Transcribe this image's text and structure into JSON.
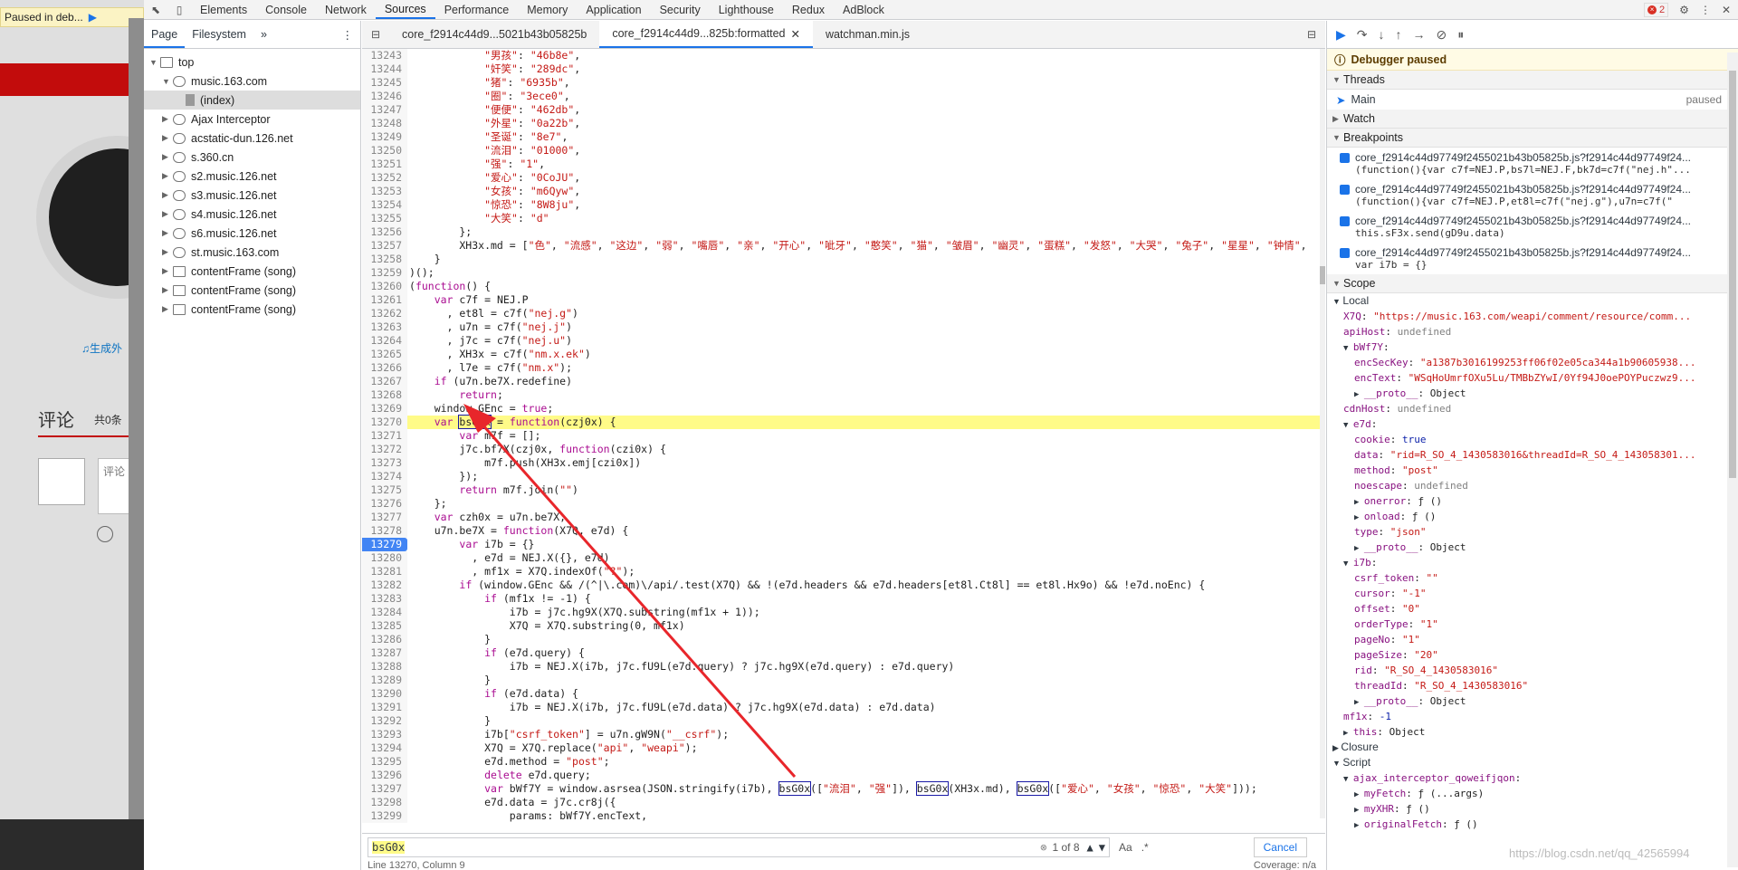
{
  "page": {
    "paused_label": "Paused in deb...",
    "lyric_link": "♫生成外",
    "comment_title": "评论",
    "comment_count": "共0条",
    "comment_placeholder": "评论"
  },
  "tabs": [
    "Elements",
    "Console",
    "Network",
    "Sources",
    "Performance",
    "Memory",
    "Application",
    "Security",
    "Lighthouse",
    "Redux",
    "AdBlock"
  ],
  "active_tab": "Sources",
  "error_count": "2",
  "navigator": {
    "tabs": [
      "Page",
      "Filesystem"
    ],
    "more": "»",
    "items": [
      {
        "label": "top",
        "icon": "folder",
        "depth": 0,
        "open": true
      },
      {
        "label": "music.163.com",
        "icon": "cloud",
        "depth": 1,
        "open": true
      },
      {
        "label": "(index)",
        "icon": "file",
        "depth": 2,
        "open": false,
        "selected": true
      },
      {
        "label": "Ajax Interceptor",
        "icon": "cloud",
        "depth": 1
      },
      {
        "label": "acstatic-dun.126.net",
        "icon": "cloud",
        "depth": 1
      },
      {
        "label": "s.360.cn",
        "icon": "cloud",
        "depth": 1
      },
      {
        "label": "s2.music.126.net",
        "icon": "cloud",
        "depth": 1
      },
      {
        "label": "s3.music.126.net",
        "icon": "cloud",
        "depth": 1
      },
      {
        "label": "s4.music.126.net",
        "icon": "cloud",
        "depth": 1
      },
      {
        "label": "s6.music.126.net",
        "icon": "cloud",
        "depth": 1
      },
      {
        "label": "st.music.163.com",
        "icon": "cloud",
        "depth": 1
      },
      {
        "label": "contentFrame (song)",
        "icon": "folder",
        "depth": 1
      },
      {
        "label": "contentFrame (song)",
        "icon": "folder",
        "depth": 1
      },
      {
        "label": "contentFrame (song)",
        "icon": "folder",
        "depth": 1
      }
    ]
  },
  "editor_tabs": [
    {
      "label": "core_f2914c44d9...5021b43b05825b",
      "active": false
    },
    {
      "label": "core_f2914c44d9...825b:formatted",
      "active": true,
      "closable": true
    },
    {
      "label": "watchman.min.js",
      "active": false
    }
  ],
  "code": {
    "breakpoint_line": 13279,
    "highlight_line": 13270,
    "lines": [
      [
        13243,
        "            \"男孩\": \"46b8e\","
      ],
      [
        13244,
        "            \"奸笑\": \"289dc\","
      ],
      [
        13245,
        "            \"猪\": \"6935b\","
      ],
      [
        13246,
        "            \"圈\": \"3ece0\","
      ],
      [
        13247,
        "            \"便便\": \"462db\","
      ],
      [
        13248,
        "            \"外星\": \"0a22b\","
      ],
      [
        13249,
        "            \"圣诞\": \"8e7\","
      ],
      [
        13250,
        "            \"流泪\": \"01000\","
      ],
      [
        13251,
        "            \"强\": \"1\","
      ],
      [
        13252,
        "            \"爱心\": \"0CoJU\","
      ],
      [
        13253,
        "            \"女孩\": \"m6Qyw\","
      ],
      [
        13254,
        "            \"惊恐\": \"8W8ju\","
      ],
      [
        13255,
        "            \"大笑\": \"d\""
      ],
      [
        13256,
        "        };"
      ],
      [
        13257,
        "        XH3x.md = [\"色\", \"流感\", \"这边\", \"弱\", \"嘴唇\", \"亲\", \"开心\", \"呲牙\", \"憨笑\", \"猫\", \"皱眉\", \"幽灵\", \"蛋糕\", \"发怒\", \"大哭\", \"兔子\", \"星星\", \"钟情\","
      ],
      [
        13258,
        "    }"
      ],
      [
        13259,
        ")();"
      ],
      [
        13260,
        "(function() {"
      ],
      [
        13261,
        "    var c7f = NEJ.P"
      ],
      [
        13262,
        "      , et8l = c7f(\"nej.g\")"
      ],
      [
        13263,
        "      , u7n = c7f(\"nej.j\")"
      ],
      [
        13264,
        "      , j7c = c7f(\"nej.u\")"
      ],
      [
        13265,
        "      , XH3x = c7f(\"nm.x.ek\")"
      ],
      [
        13266,
        "      , l7e = c7f(\"nm.x\");"
      ],
      [
        13267,
        "    if (u7n.be7X.redefine)"
      ],
      [
        13268,
        "        return;"
      ],
      [
        13269,
        "    window.GEnc = true;"
      ],
      [
        13270,
        "    var bsG0x = function(czj0x) {"
      ],
      [
        13271,
        "        var m7f = [];"
      ],
      [
        13272,
        "        j7c.bf7X(czj0x, function(czi0x) {"
      ],
      [
        13273,
        "            m7f.push(XH3x.emj[czi0x])"
      ],
      [
        13274,
        "        });"
      ],
      [
        13275,
        "        return m7f.join(\"\")"
      ],
      [
        13276,
        "    };"
      ],
      [
        13277,
        "    var czh0x = u7n.be7X;"
      ],
      [
        13278,
        "    u7n.be7X = function(X7Q, e7d) {"
      ],
      [
        13279,
        "        var i7b = {}"
      ],
      [
        13280,
        "          , e7d = NEJ.X({}, e7d)"
      ],
      [
        13281,
        "          , mf1x = X7Q.indexOf(\"?\");"
      ],
      [
        13282,
        "        if (window.GEnc && /(^|\\.com)\\/api/.test(X7Q) && !(e7d.headers && e7d.headers[et8l.Ct8l] == et8l.Hx9o) && !e7d.noEnc) {"
      ],
      [
        13283,
        "            if (mf1x != -1) {"
      ],
      [
        13284,
        "                i7b = j7c.hg9X(X7Q.substring(mf1x + 1));"
      ],
      [
        13285,
        "                X7Q = X7Q.substring(0, mf1x)"
      ],
      [
        13286,
        "            }"
      ],
      [
        13287,
        "            if (e7d.query) {"
      ],
      [
        13288,
        "                i7b = NEJ.X(i7b, j7c.fU9L(e7d.query) ? j7c.hg9X(e7d.query) : e7d.query)"
      ],
      [
        13289,
        "            }"
      ],
      [
        13290,
        "            if (e7d.data) {"
      ],
      [
        13291,
        "                i7b = NEJ.X(i7b, j7c.fU9L(e7d.data) ? j7c.hg9X(e7d.data) : e7d.data)"
      ],
      [
        13292,
        "            }"
      ],
      [
        13293,
        "            i7b[\"csrf_token\"] = u7n.gW9N(\"__csrf\");"
      ],
      [
        13294,
        "            X7Q = X7Q.replace(\"api\", \"weapi\");"
      ],
      [
        13295,
        "            e7d.method = \"post\";"
      ],
      [
        13296,
        "            delete e7d.query;"
      ],
      [
        13297,
        "            var bWf7Y = window.asrsea(JSON.stringify(i7b), bsG0x([\"流泪\", \"强\"]), bsG0x(XH3x.md), bsG0x([\"爱心\", \"女孩\", \"惊恐\", \"大笑\"]));"
      ],
      [
        13298,
        "            e7d.data = j7c.cr8j({"
      ],
      [
        13299,
        "                params: bWf7Y.encText,"
      ]
    ]
  },
  "search": {
    "query": "bsG0x",
    "match": "1 of 8",
    "aa": "Aa",
    "regex": ".*",
    "cancel": "Cancel"
  },
  "status": {
    "position": "Line 13270, Column 9",
    "coverage": "Coverage: n/a"
  },
  "sidebar": {
    "paused": "Debugger paused",
    "threads_label": "Threads",
    "thread_name": "Main",
    "thread_state": "paused",
    "watch_label": "Watch",
    "breakpoints_label": "Breakpoints",
    "breakpoints": [
      {
        "file": "core_f2914c44d97749f2455021b43b05825b.js?f2914c44d97749f24...",
        "code": "(function(){var c7f=NEJ.P,bs7l=NEJ.F,bk7d=c7f(\"nej.h\"..."
      },
      {
        "file": "core_f2914c44d97749f2455021b43b05825b.js?f2914c44d97749f24...",
        "code": "(function(){var c7f=NEJ.P,et8l=c7f(\"nej.g\"),u7n=c7f(\""
      },
      {
        "file": "core_f2914c44d97749f2455021b43b05825b.js?f2914c44d97749f24...",
        "code": "this.sF3x.send(gD9u.data)"
      },
      {
        "file": "core_f2914c44d97749f2455021b43b05825b.js?f2914c44d97749f24...",
        "code": "var i7b = {}"
      }
    ],
    "scope_label": "Scope",
    "local_label": "Local",
    "closure_label": "Closure",
    "script_label": "Script",
    "scope": [
      {
        "d": 1,
        "k": "X7Q",
        "v": "\"https://music.163.com/weapi/comment/resource/comm...",
        "t": "s"
      },
      {
        "d": 1,
        "k": "apiHost",
        "v": "undefined",
        "t": "u"
      },
      {
        "d": 1,
        "k": "bWf7Y",
        "v": "",
        "t": "o",
        "open": true
      },
      {
        "d": 2,
        "k": "encSecKey",
        "v": "\"a1387b3016199253ff06f02e05ca344a1b90605938...",
        "t": "s"
      },
      {
        "d": 2,
        "k": "encText",
        "v": "\"WSqHoUmrfOXu5Lu/TMBbZYwI/0Yf94J0oePOYPuczwz9...",
        "t": "s"
      },
      {
        "d": 2,
        "k": "__proto__",
        "v": "Object",
        "t": "p",
        "closed": true
      },
      {
        "d": 1,
        "k": "cdnHost",
        "v": "undefined",
        "t": "u"
      },
      {
        "d": 1,
        "k": "e7d",
        "v": "",
        "t": "o",
        "open": true
      },
      {
        "d": 2,
        "k": "cookie",
        "v": "true",
        "t": "b"
      },
      {
        "d": 2,
        "k": "data",
        "v": "\"rid=R_SO_4_1430583016&threadId=R_SO_4_143058301...",
        "t": "s"
      },
      {
        "d": 2,
        "k": "method",
        "v": "\"post\"",
        "t": "s"
      },
      {
        "d": 2,
        "k": "noescape",
        "v": "undefined",
        "t": "u"
      },
      {
        "d": 2,
        "k": "onerror",
        "v": "ƒ ()",
        "t": "f",
        "closed": true
      },
      {
        "d": 2,
        "k": "onload",
        "v": "ƒ ()",
        "t": "f",
        "closed": true
      },
      {
        "d": 2,
        "k": "type",
        "v": "\"json\"",
        "t": "s"
      },
      {
        "d": 2,
        "k": "__proto__",
        "v": "Object",
        "t": "p",
        "closed": true
      },
      {
        "d": 1,
        "k": "i7b",
        "v": "",
        "t": "o",
        "open": true
      },
      {
        "d": 2,
        "k": "csrf_token",
        "v": "\"\"",
        "t": "s"
      },
      {
        "d": 2,
        "k": "cursor",
        "v": "\"-1\"",
        "t": "s"
      },
      {
        "d": 2,
        "k": "offset",
        "v": "\"0\"",
        "t": "s"
      },
      {
        "d": 2,
        "k": "orderType",
        "v": "\"1\"",
        "t": "s"
      },
      {
        "d": 2,
        "k": "pageNo",
        "v": "\"1\"",
        "t": "s"
      },
      {
        "d": 2,
        "k": "pageSize",
        "v": "\"20\"",
        "t": "s"
      },
      {
        "d": 2,
        "k": "rid",
        "v": "\"R_SO_4_1430583016\"",
        "t": "s"
      },
      {
        "d": 2,
        "k": "threadId",
        "v": "\"R_SO_4_1430583016\"",
        "t": "s"
      },
      {
        "d": 2,
        "k": "__proto__",
        "v": "Object",
        "t": "p",
        "closed": true
      },
      {
        "d": 1,
        "k": "mf1x",
        "v": "-1",
        "t": "b"
      },
      {
        "d": 1,
        "k": "this",
        "v": "Object",
        "t": "p",
        "closed": true
      }
    ],
    "script_items": [
      {
        "d": 1,
        "k": "ajax_interceptor_qoweifjqon",
        "v": "",
        "t": "o",
        "open": true
      },
      {
        "d": 2,
        "k": "myFetch",
        "v": "ƒ (...args)",
        "t": "f",
        "closed": true
      },
      {
        "d": 2,
        "k": "myXHR",
        "v": "ƒ ()",
        "t": "f",
        "closed": true
      },
      {
        "d": 2,
        "k": "originalFetch",
        "v": "ƒ ()",
        "t": "f",
        "closed": true
      }
    ]
  },
  "watermark": "https://blog.csdn.net/qq_42565994",
  "colors": {
    "accent": "#1a73e8",
    "highlight": "#fffb88",
    "arrow": "#e8262b",
    "brand_red": "#c20c0c"
  }
}
